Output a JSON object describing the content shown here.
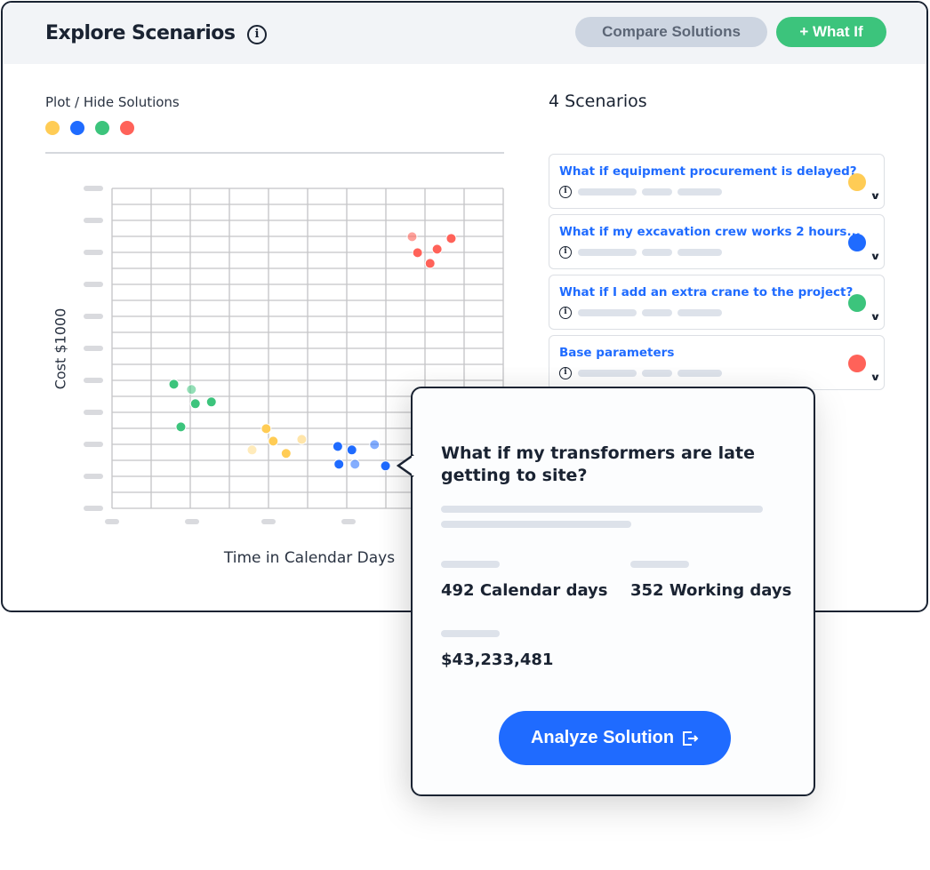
{
  "header": {
    "title": "Explore Scenarios",
    "compare_label": "Compare Solutions",
    "what_if_label": "+ What If"
  },
  "plot": {
    "label": "Plot / Hide Solutions",
    "toggles": [
      {
        "color": "#ffcc55"
      },
      {
        "color": "#1f6bff"
      },
      {
        "color": "#3cc47c"
      },
      {
        "color": "#ff6259"
      }
    ]
  },
  "scenarios": {
    "count_label": "4 Scenarios",
    "items": [
      {
        "title": "What if equipment procurement is delayed?",
        "color": "#ffcc55"
      },
      {
        "title": "What if my excavation crew works 2 hours...",
        "color": "#1f6bff"
      },
      {
        "title": "What if I add an extra crane to the project?",
        "color": "#3cc47c"
      },
      {
        "title": "Base parameters",
        "color": "#ff6259"
      }
    ]
  },
  "chart_data": {
    "type": "scatter",
    "xlabel": "Time in Calendar Days",
    "ylabel": "Cost $1000",
    "xlim": [
      0,
      10
    ],
    "ylim": [
      0,
      20
    ],
    "grid": true,
    "series": [
      {
        "color": "#ffcc55",
        "points": [
          [
            3.94,
            4.98,
            1
          ],
          [
            4.12,
            4.2,
            1
          ],
          [
            4.85,
            4.31,
            0.5
          ],
          [
            3.58,
            3.65,
            0.4
          ],
          [
            4.45,
            3.43,
            1
          ]
        ]
      },
      {
        "color": "#1f6bff",
        "points": [
          [
            5.77,
            3.87,
            1
          ],
          [
            6.13,
            3.65,
            1
          ],
          [
            6.71,
            3.98,
            0.55
          ],
          [
            5.8,
            2.76,
            1
          ],
          [
            6.21,
            2.76,
            0.55
          ],
          [
            6.99,
            2.65,
            1
          ]
        ]
      },
      {
        "color": "#3cc47c",
        "points": [
          [
            1.58,
            7.76,
            1
          ],
          [
            2.03,
            7.43,
            0.55
          ],
          [
            2.13,
            6.54,
            1
          ],
          [
            2.54,
            6.65,
            1
          ],
          [
            1.76,
            5.09,
            1
          ]
        ]
      },
      {
        "color": "#ff6259",
        "points": [
          [
            7.67,
            16.98,
            0.6
          ],
          [
            7.81,
            15.98,
            1
          ],
          [
            8.31,
            16.2,
            1
          ],
          [
            8.67,
            16.87,
            1
          ],
          [
            8.13,
            15.31,
            1
          ]
        ]
      }
    ]
  },
  "popup": {
    "title": "What if my transformers are late getting to site?",
    "calendar_days": "492 Calendar days",
    "working_days": "352 Working days",
    "cost": "$43,233,481",
    "analyze_label": "Analyze Solution"
  }
}
